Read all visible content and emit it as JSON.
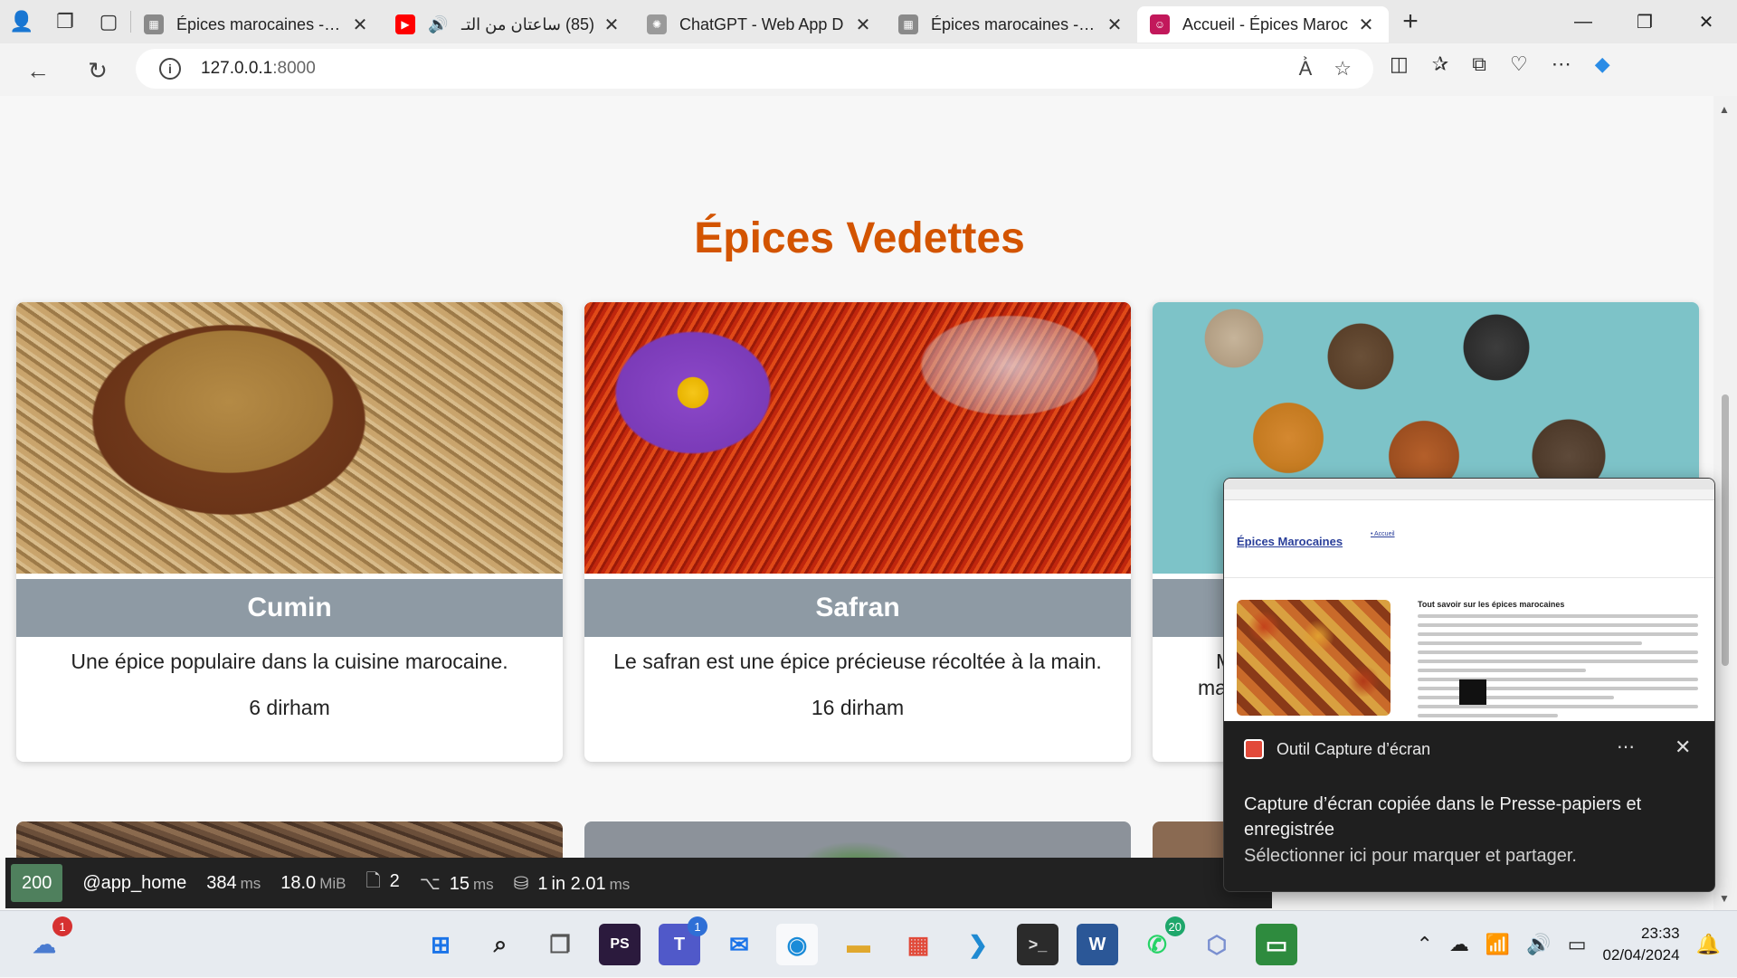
{
  "browser": {
    "tabs": [
      {
        "title": "Épices marocaines - cu",
        "fav_color": "#8a8a8a",
        "fav_glyph": "▦",
        "active": false
      },
      {
        "title": "(85) ساعتان من التـ",
        "fav_color": "#ff0000",
        "fav_glyph": "▶",
        "active": false,
        "audio": true
      },
      {
        "title": "ChatGPT - Web App D",
        "fav_color": "#9a9a9a",
        "fav_glyph": "✺",
        "active": false
      },
      {
        "title": "Épices marocaines - cu",
        "fav_color": "#8a8a8a",
        "fav_glyph": "▦",
        "active": false
      },
      {
        "title": "Accueil - Épices Maroc",
        "fav_color": "#c2185b",
        "fav_glyph": "☺",
        "active": true
      }
    ],
    "url_host": "127.0.0.1",
    "url_port": ":8000"
  },
  "page": {
    "section_title": "Épices Vedettes",
    "products": [
      {
        "name": "Cumin",
        "description": "Une épice populaire dans la cuisine marocaine.",
        "price": "6 dirham"
      },
      {
        "name": "Safran",
        "description": "Le safran est une épice précieuse récoltée à la main.",
        "price": "16 dirham"
      },
      {
        "name": "",
        "description": "M",
        "description_line2": "ma",
        "price": ""
      }
    ]
  },
  "debug_toolbar": {
    "status": "200",
    "route": "@app_home",
    "time_value": "384",
    "time_unit": "ms",
    "memory_value": "18.0",
    "memory_unit": "MiB",
    "logs": "2",
    "twig_value": "15",
    "twig_unit": "ms",
    "db_value": "1",
    "db_in": "in 2.01",
    "db_unit": "ms"
  },
  "notification": {
    "app_name": "Outil Capture d’écran",
    "message": "Capture d’écran copiée dans le Presse-papiers et enregistrée",
    "subtext": "Sélectionner ici pour marquer et partager.",
    "preview": {
      "brand": "Épices Marocaines",
      "nav": "• Accueil",
      "heading": "Tout savoir sur les épices marocaines"
    }
  },
  "taskbar": {
    "weather_badge": "1",
    "teams_badge": "1",
    "whatsapp_badge": "20",
    "time": "23:33",
    "date": "02/04/2024"
  }
}
